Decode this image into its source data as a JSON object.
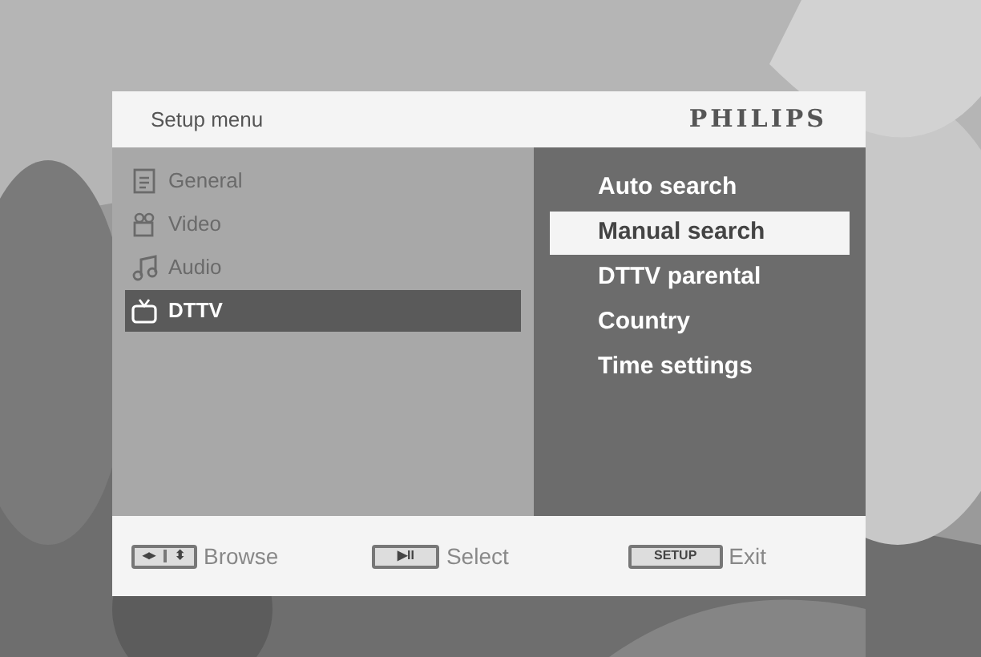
{
  "header": {
    "title": "Setup menu",
    "brand": "PHILIPS"
  },
  "categories": [
    {
      "label": "General",
      "kind": "document",
      "selected": false
    },
    {
      "label": "Video",
      "kind": "video",
      "selected": false
    },
    {
      "label": "Audio",
      "kind": "music",
      "selected": false
    },
    {
      "label": "DTTV",
      "kind": "tv",
      "selected": true
    }
  ],
  "options": [
    {
      "label": "Auto search",
      "selected": false
    },
    {
      "label": "Manual search",
      "selected": true
    },
    {
      "label": "DTTV parental",
      "selected": false
    },
    {
      "label": "Country",
      "selected": false
    },
    {
      "label": "Time settings",
      "selected": false
    }
  ],
  "footer": [
    {
      "keys": [
        "◂▸",
        "⬍"
      ],
      "label": "Browse"
    },
    {
      "keys": [
        "▶II"
      ],
      "label": "Select"
    },
    {
      "keys": [
        "SETUP"
      ],
      "label": "Exit"
    }
  ]
}
